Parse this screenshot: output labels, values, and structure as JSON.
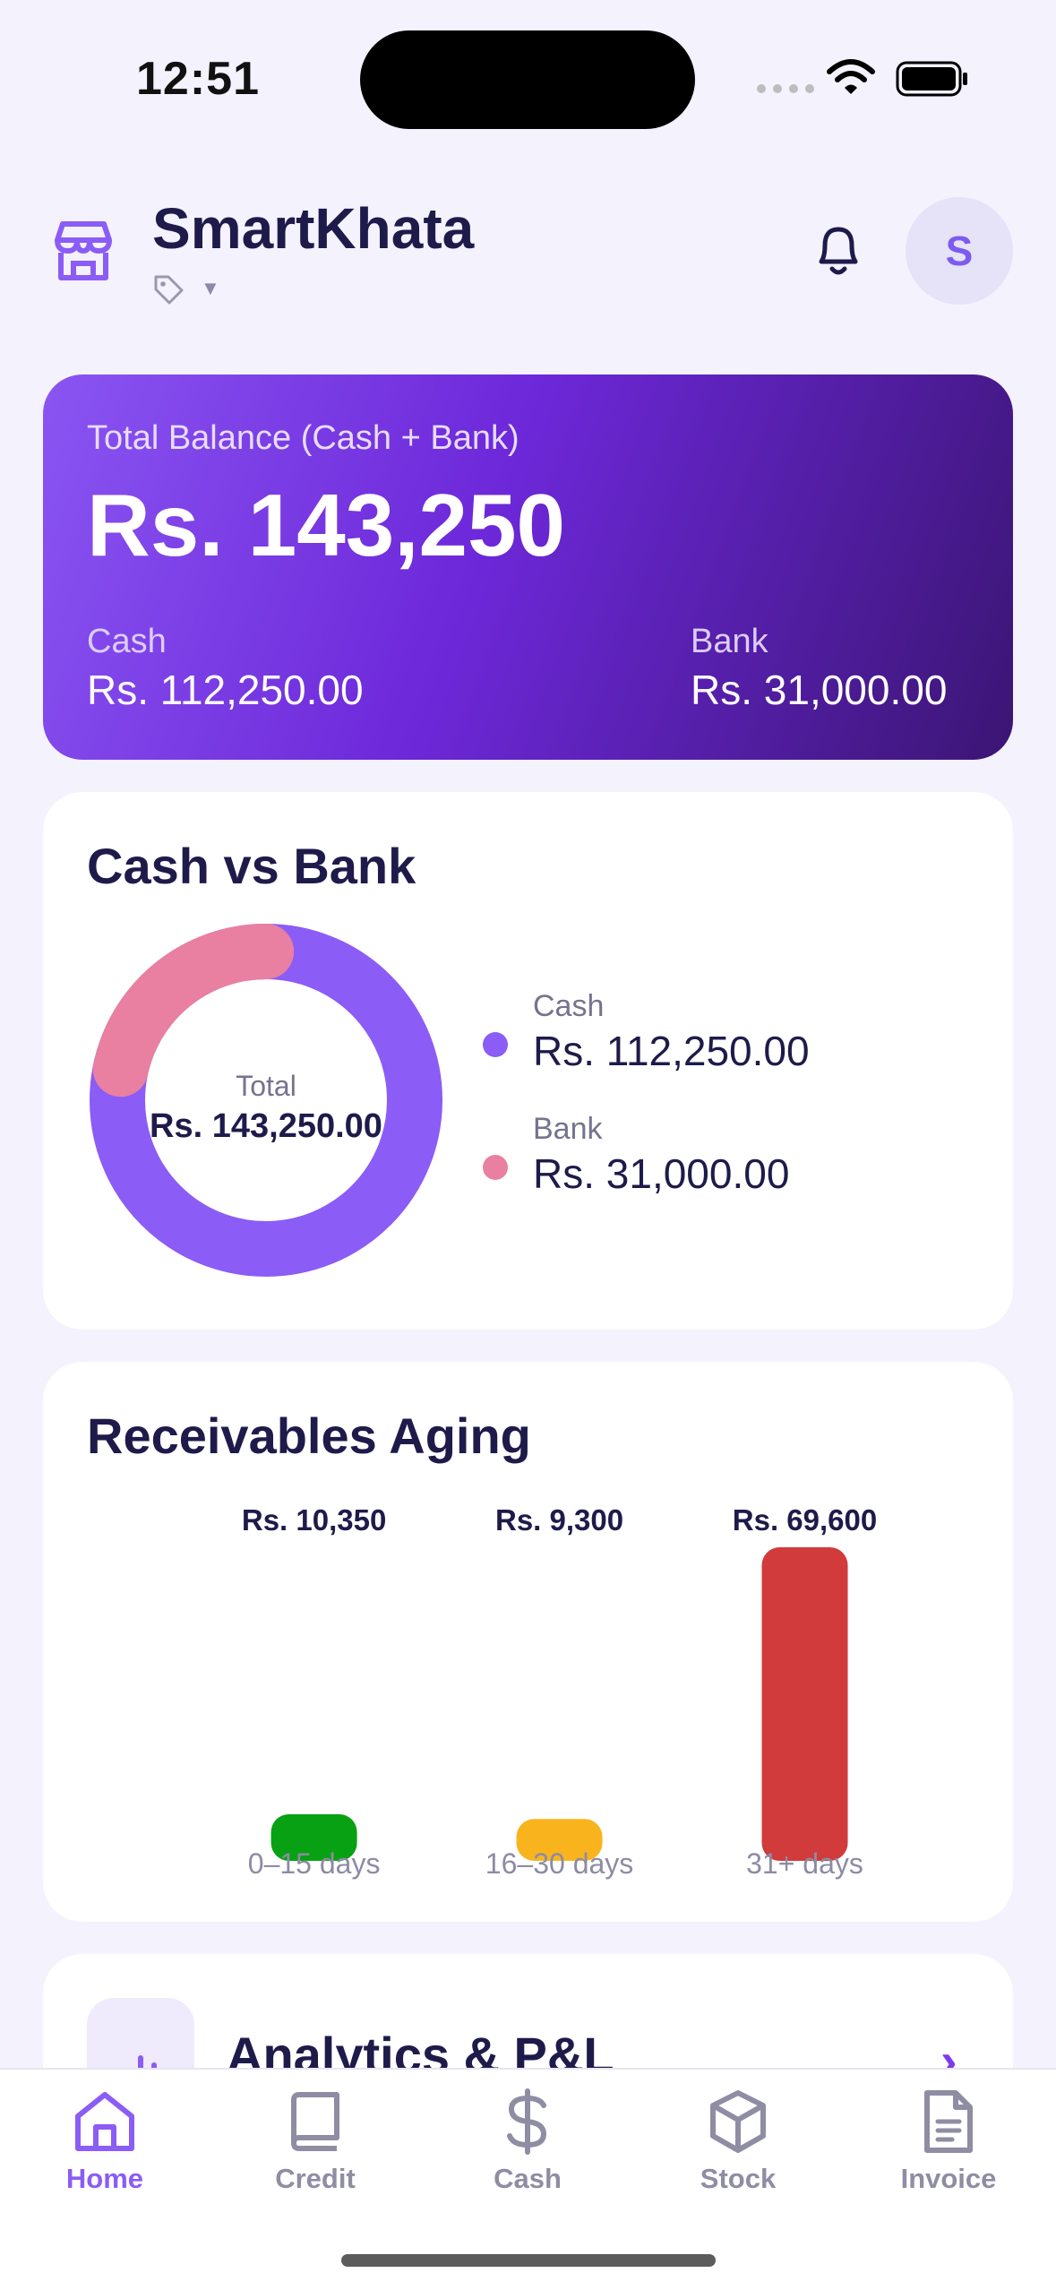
{
  "status_bar": {
    "time": "12:51"
  },
  "header": {
    "app_title": "SmartKhata",
    "avatar_initial": "S",
    "icons": {
      "shop": "storefront-icon",
      "tag": "tag-icon",
      "bell": "bell-icon"
    }
  },
  "balance_card": {
    "label": "Total Balance (Cash + Bank)",
    "amount": "Rs. 143,250",
    "cash_label": "Cash",
    "cash_value": "Rs. 112,250.00",
    "bank_label": "Bank",
    "bank_value": "Rs. 31,000.00"
  },
  "cash_vs_bank": {
    "title": "Cash vs Bank",
    "total_label": "Total",
    "total_value": "Rs. 143,250.00",
    "legend": [
      {
        "name": "Cash",
        "value": "Rs. 112,250.00",
        "color": "#8b5cf6"
      },
      {
        "name": "Bank",
        "value": "Rs. 31,000.00",
        "color": "#e97fa1"
      }
    ]
  },
  "receivables_aging": {
    "title": "Receivables Aging"
  },
  "chart_data": [
    {
      "type": "pie",
      "categories": [
        "Cash",
        "Bank"
      ],
      "values": [
        112250,
        31000
      ],
      "colors": [
        "#8b5cf6",
        "#e97fa1"
      ]
    },
    {
      "type": "bar",
      "categories": [
        "0–15 days",
        "16–30 days",
        "31+ days"
      ],
      "values": [
        10350,
        9300,
        69600
      ],
      "data_labels": [
        "Rs. 10,350",
        "Rs. 9,300",
        "Rs. 69,600"
      ],
      "colors": [
        "#08a113",
        "#f9b41d",
        "#d13b3b"
      ],
      "ylim": [
        0,
        69600
      ]
    }
  ],
  "analytics": {
    "title": "Analytics & P&L",
    "chevron": "›"
  },
  "bottom_nav": [
    {
      "label": "Home",
      "icon": "home-icon",
      "active": true
    },
    {
      "label": "Credit",
      "icon": "book-icon",
      "active": false
    },
    {
      "label": "Cash",
      "icon": "dollar-icon",
      "active": false
    },
    {
      "label": "Stock",
      "icon": "box-icon",
      "active": false
    },
    {
      "label": "Invoice",
      "icon": "document-icon",
      "active": false
    }
  ]
}
